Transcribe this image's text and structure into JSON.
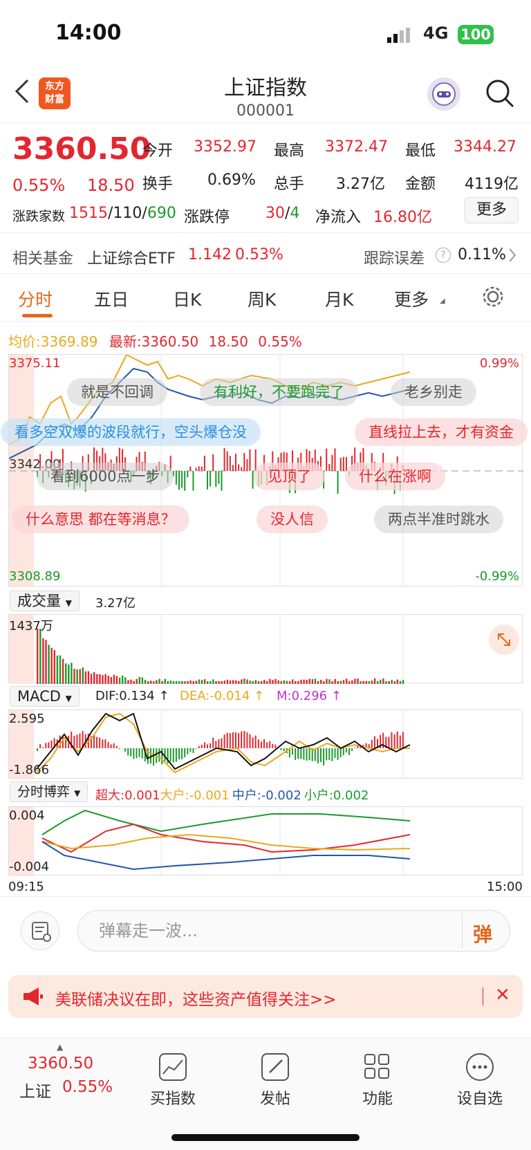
{
  "status": {
    "time": "14:00",
    "network": "4G",
    "battery": "100"
  },
  "header": {
    "title": "上证指数",
    "code": "000001",
    "logo_text_1": "东方",
    "logo_text_2": "财富"
  },
  "quote": {
    "price": "3360.50",
    "pct": "0.55%",
    "change": "18.50",
    "open_label": "今开",
    "open": "3352.97",
    "high_label": "最高",
    "high": "3372.47",
    "low_label": "最低",
    "low": "3344.27",
    "turnover_label": "换手",
    "turnover": "0.69%",
    "volume_label": "总手",
    "volume": "3.27亿",
    "amount_label": "金额",
    "amount": "4119亿",
    "breadth_label": "涨跌家数",
    "up": "1515",
    "flat": "110",
    "down": "690",
    "limit_label": "涨跌停",
    "limit_up": "30",
    "limit_down": "4",
    "inflow_label": "净流入",
    "inflow": "16.80亿",
    "more": "更多"
  },
  "fund": {
    "label": "相关基金",
    "name": "上证综合ETF",
    "price": "1.142",
    "pct": "0.53%",
    "err_label": "跟踪误差",
    "err": "0.11%"
  },
  "tabs": [
    "分时",
    "五日",
    "日K",
    "周K",
    "月K",
    "更多"
  ],
  "intraday": {
    "avg_label": "均价:",
    "avg": "3369.89",
    "latest_label": "最新:",
    "latest": "3360.50",
    "chg": "18.50",
    "pct": "0.55%",
    "top": "3375.11",
    "mid": "3342.00",
    "bottom": "3308.89",
    "top_pct": "0.99%",
    "bottom_pct": "-0.99%"
  },
  "danmu": [
    "就是不回调",
    "有利好，不要跑完了",
    "老乡别走",
    "看多空双爆的波段就行，空头爆仓没",
    "直线拉上去，才有资金",
    "看到6000点一步",
    "见顶了",
    "什么在涨啊",
    "什么意思 都在等消息？",
    "没人信",
    "两点半准时跳水"
  ],
  "volume": {
    "label": "成交量",
    "total": "3.27亿",
    "max": "1437万"
  },
  "macd": {
    "label": "MACD",
    "dif": "DIF:0.134 ↑",
    "dea": "DEA:-0.014 ↑",
    "m": "M:0.296 ↑",
    "top": "2.595",
    "bottom": "-1.866"
  },
  "flow": {
    "label": "分时博弈",
    "super": "超大:0.001",
    "big": "大户:-0.001",
    "mid": "中户:-0.002",
    "small": "小户:0.002",
    "top": "0.004",
    "bottom": "-0.004"
  },
  "time_axis": {
    "start": "09:15",
    "end": "15:00"
  },
  "comment": {
    "placeholder": "弹幕走一波...",
    "toggle": "弹"
  },
  "banner": {
    "text": "美联储决议在即，这些资产值得关注>>"
  },
  "bottom": {
    "price": "3360.50",
    "name": "上证",
    "pct": "0.55%",
    "items": [
      "买指数",
      "发帖",
      "功能",
      "设自选"
    ]
  }
}
